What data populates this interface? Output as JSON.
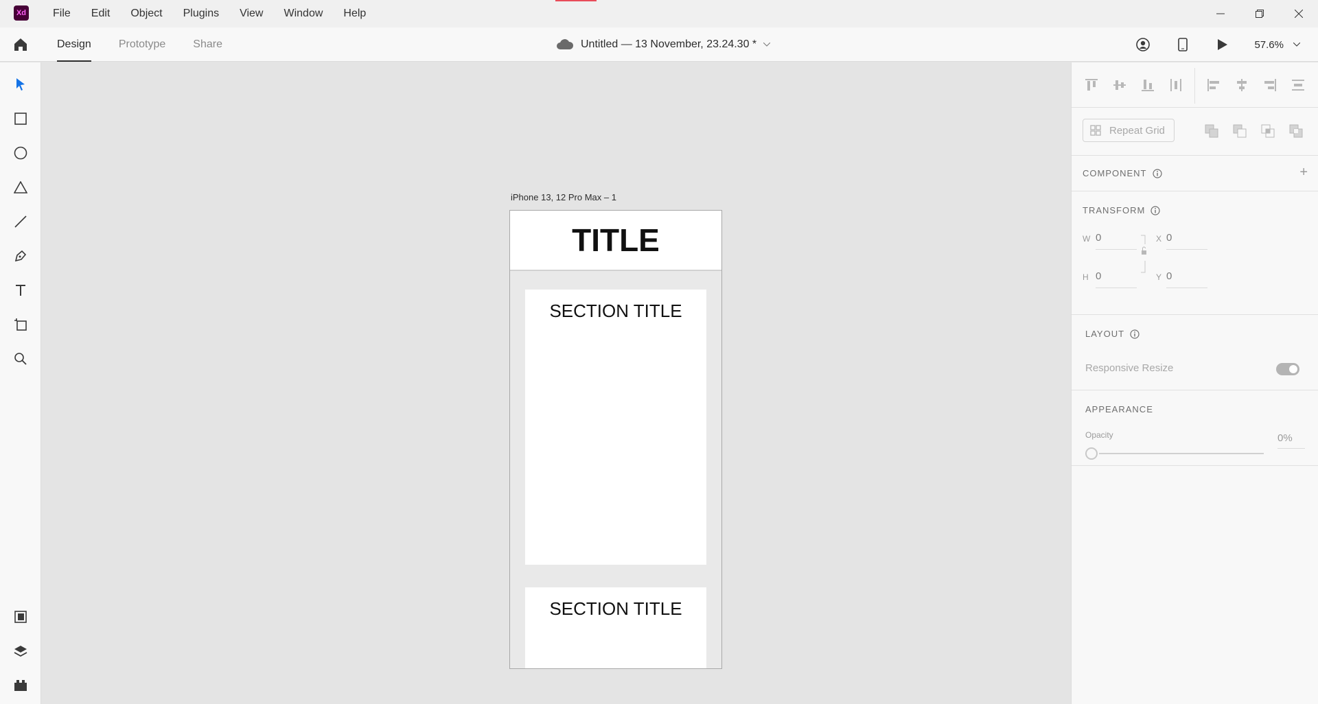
{
  "app": {
    "logo_text": "Xd",
    "brand_color": "#470137",
    "logo_accent": "#ff61f6"
  },
  "menu": [
    "File",
    "Edit",
    "Object",
    "Plugins",
    "View",
    "Window",
    "Help"
  ],
  "header": {
    "tabs": [
      {
        "label": "Design",
        "active": true
      },
      {
        "label": "Prototype",
        "active": false
      },
      {
        "label": "Share",
        "active": false
      }
    ],
    "doc_title": "Untitled — 13 November, 23.24.30 *",
    "zoom": "57.6%"
  },
  "tools": [
    "select-icon",
    "rectangle-icon",
    "ellipse-icon",
    "polygon-icon",
    "line-icon",
    "pen-icon",
    "text-icon",
    "artboard-icon",
    "zoom-icon"
  ],
  "bottom_tools": [
    "assets-icon",
    "layers-icon",
    "plugins-icon"
  ],
  "artboard": {
    "label": "iPhone 13, 12 Pro Max – 1",
    "title": "TITLE",
    "sections": [
      "SECTION TITLE",
      "SECTION TITLE"
    ]
  },
  "inspector": {
    "repeat_grid": "Repeat Grid",
    "component": {
      "heading": "COMPONENT",
      "add": "+"
    },
    "transform": {
      "heading": "TRANSFORM",
      "w_label": "W",
      "w": "0",
      "h_label": "H",
      "h": "0",
      "x_label": "X",
      "x": "0",
      "y_label": "Y",
      "y": "0"
    },
    "layout": {
      "heading": "LAYOUT",
      "responsive_resize": "Responsive Resize",
      "responsive_on": true
    },
    "appearance": {
      "heading": "APPEARANCE",
      "opacity_label": "Opacity",
      "opacity": "0%"
    }
  }
}
